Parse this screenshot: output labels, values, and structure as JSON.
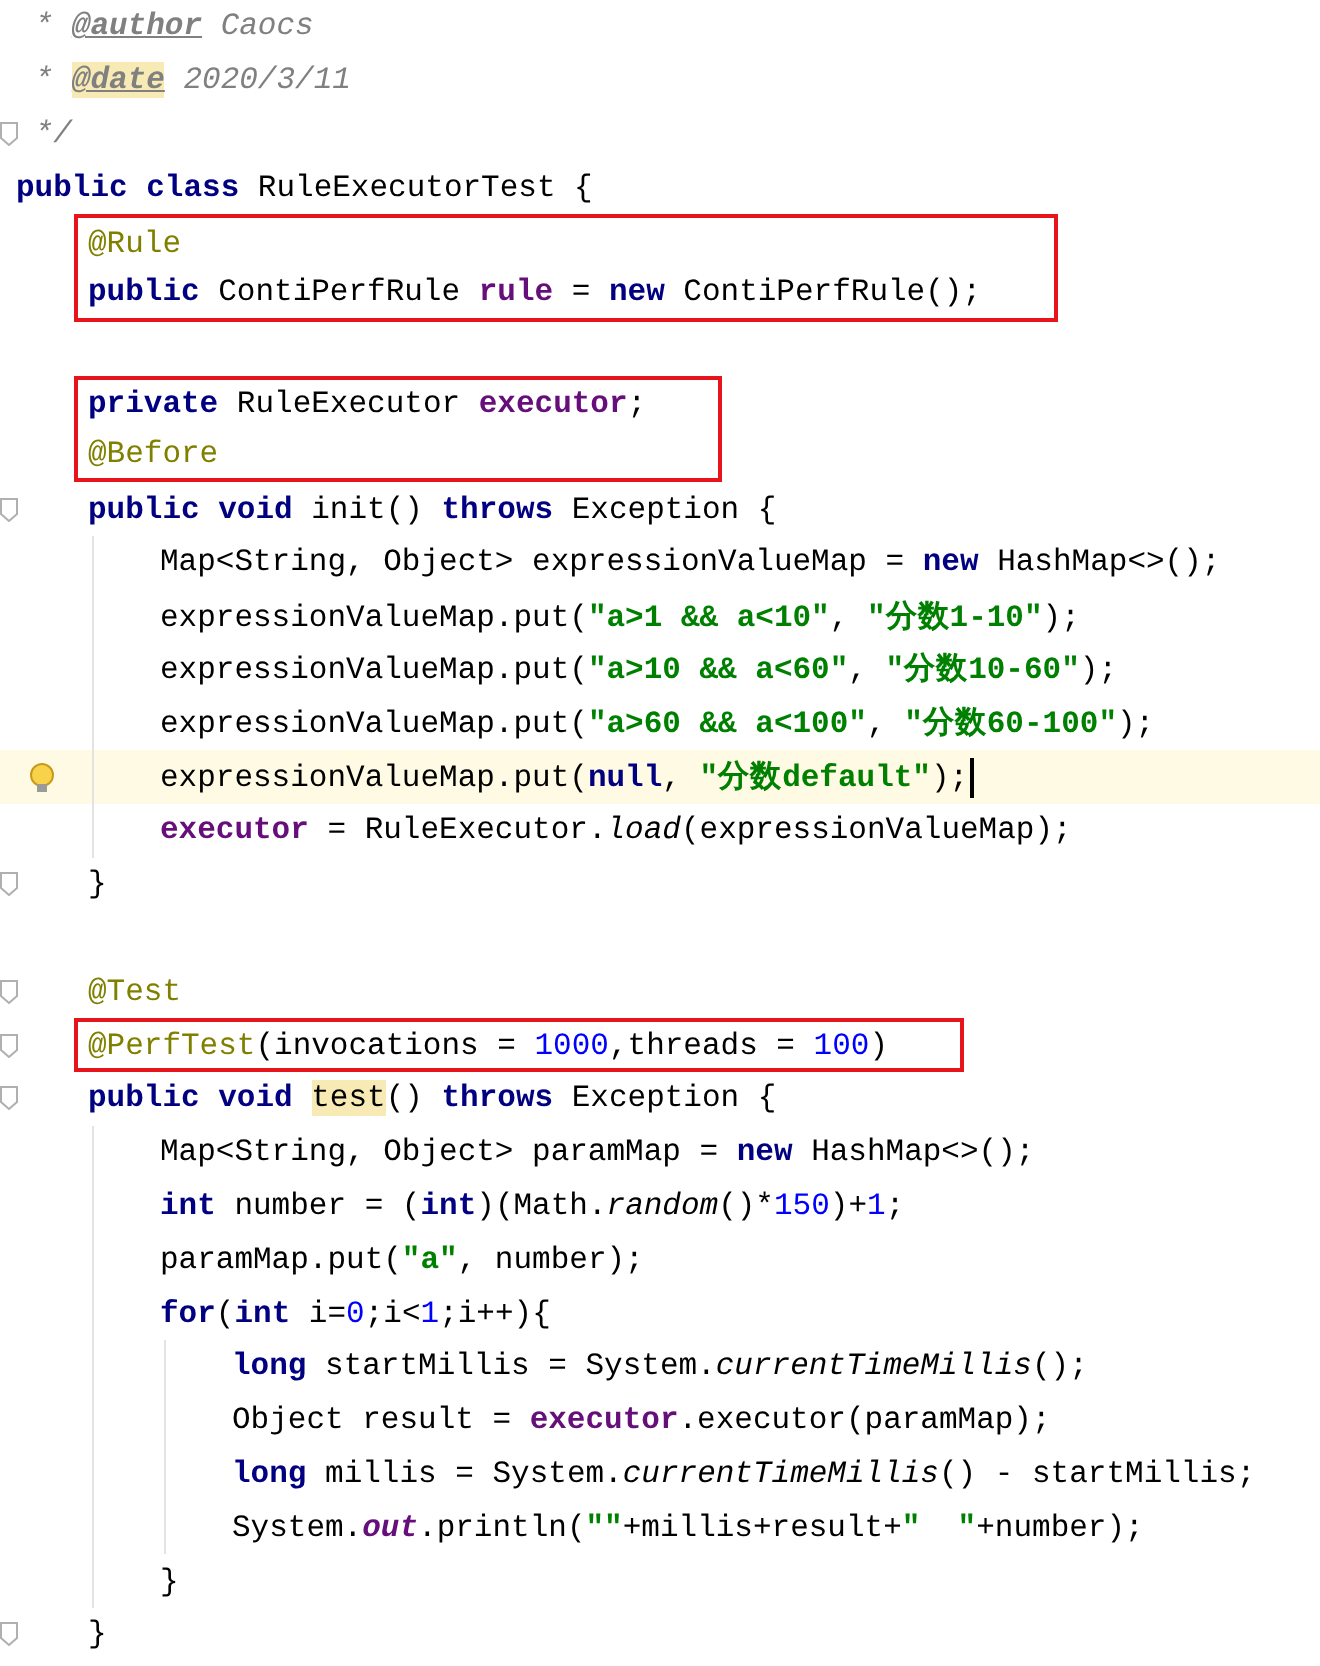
{
  "editor": {
    "lines": [
      {
        "kind": "code",
        "fold": false,
        "current": false,
        "tokens": [
          {
            "kind": "comment",
            "text": " * "
          },
          {
            "kind": "doc_tag",
            "text": "@author"
          },
          {
            "kind": "comment",
            "text": " Caocs"
          }
        ]
      },
      {
        "kind": "code",
        "fold": false,
        "current": false,
        "tokens": [
          {
            "kind": "comment",
            "text": " * "
          },
          {
            "kind": "doc_tag",
            "text": "@date",
            "highlighted": true
          },
          {
            "kind": "comment",
            "text": " 2020/3/11"
          }
        ]
      },
      {
        "kind": "code",
        "fold": true,
        "current": false,
        "tokens": [
          {
            "kind": "comment",
            "text": " */"
          }
        ]
      },
      {
        "kind": "code",
        "fold": false,
        "current": false,
        "tokens": [
          {
            "kind": "keyword",
            "text": "public class"
          },
          {
            "kind": "plain",
            "text": " RuleExecutorTest {"
          }
        ],
        "children": [
          {
            "kind": "group",
            "boxed": true,
            "lines": [
              {
                "kind": "code",
                "current": false,
                "tokens": [
                  {
                    "kind": "annotation",
                    "text": "@Rule"
                  }
                ]
              },
              {
                "kind": "code",
                "current": false,
                "tokens": [
                  {
                    "kind": "keyword",
                    "text": "public"
                  },
                  {
                    "kind": "plain",
                    "text": " ContiPerfRule "
                  },
                  {
                    "kind": "field",
                    "text": "rule"
                  },
                  {
                    "kind": "plain",
                    "text": " = "
                  },
                  {
                    "kind": "keyword",
                    "text": "new"
                  },
                  {
                    "kind": "plain",
                    "text": " ContiPerfRule();"
                  }
                ]
              }
            ]
          },
          {
            "kind": "blank"
          },
          {
            "kind": "group",
            "boxed": true,
            "lines": [
              {
                "kind": "code",
                "current": false,
                "tokens": [
                  {
                    "kind": "keyword",
                    "text": "private"
                  },
                  {
                    "kind": "plain",
                    "text": " RuleExecutor "
                  },
                  {
                    "kind": "field",
                    "text": "executor"
                  },
                  {
                    "kind": "plain",
                    "text": ";"
                  }
                ]
              },
              {
                "kind": "code",
                "current": false,
                "tokens": [
                  {
                    "kind": "annotation",
                    "text": "@Before"
                  }
                ]
              }
            ]
          },
          {
            "kind": "code",
            "fold": true,
            "current": false,
            "tokens": [
              {
                "kind": "keyword",
                "text": "public void"
              },
              {
                "kind": "plain",
                "text": " init() "
              },
              {
                "kind": "keyword",
                "text": "throws"
              },
              {
                "kind": "plain",
                "text": " Exception {"
              }
            ],
            "children": [
              {
                "kind": "code",
                "fold": false,
                "current": false,
                "tokens": [
                  {
                    "kind": "plain",
                    "text": "Map<String, Object> expressionValueMap = "
                  },
                  {
                    "kind": "keyword",
                    "text": "new"
                  },
                  {
                    "kind": "plain",
                    "text": " HashMap<>();"
                  }
                ]
              },
              {
                "kind": "code",
                "fold": false,
                "current": false,
                "tokens": [
                  {
                    "kind": "plain",
                    "text": "expressionValueMap.put("
                  },
                  {
                    "kind": "string",
                    "text": "\"a>1 && a<10\""
                  },
                  {
                    "kind": "plain",
                    "text": ", "
                  },
                  {
                    "kind": "string",
                    "text": "\"分数1-10\""
                  },
                  {
                    "kind": "plain",
                    "text": ");"
                  }
                ]
              },
              {
                "kind": "code",
                "fold": false,
                "current": false,
                "tokens": [
                  {
                    "kind": "plain",
                    "text": "expressionValueMap.put("
                  },
                  {
                    "kind": "string",
                    "text": "\"a>10 && a<60\""
                  },
                  {
                    "kind": "plain",
                    "text": ", "
                  },
                  {
                    "kind": "string",
                    "text": "\"分数10-60\""
                  },
                  {
                    "kind": "plain",
                    "text": ");"
                  }
                ]
              },
              {
                "kind": "code",
                "fold": false,
                "current": false,
                "tokens": [
                  {
                    "kind": "plain",
                    "text": "expressionValueMap.put("
                  },
                  {
                    "kind": "string",
                    "text": "\"a>60 && a<100\""
                  },
                  {
                    "kind": "plain",
                    "text": ", "
                  },
                  {
                    "kind": "string",
                    "text": "\"分数60-100\""
                  },
                  {
                    "kind": "plain",
                    "text": ");"
                  }
                ]
              },
              {
                "kind": "code",
                "fold": false,
                "current": true,
                "tokens": [
                  {
                    "kind": "plain",
                    "text": "expressionValueMap.put("
                  },
                  {
                    "kind": "keyword",
                    "text": "null"
                  },
                  {
                    "kind": "plain",
                    "text": ", "
                  },
                  {
                    "kind": "string",
                    "text": "\"分数default\""
                  },
                  {
                    "kind": "plain",
                    "text": ");"
                  }
                ]
              },
              {
                "kind": "code",
                "fold": false,
                "current": false,
                "tokens": [
                  {
                    "kind": "field",
                    "text": "executor"
                  },
                  {
                    "kind": "plain",
                    "text": " = RuleExecutor."
                  },
                  {
                    "kind": "static_call",
                    "text": "load"
                  },
                  {
                    "kind": "plain",
                    "text": "(expressionValueMap);"
                  }
                ]
              }
            ]
          },
          {
            "kind": "code",
            "fold": true,
            "current": false,
            "tokens": [
              {
                "kind": "plain",
                "text": "}"
              }
            ]
          },
          {
            "kind": "blank"
          },
          {
            "kind": "code",
            "fold": true,
            "current": false,
            "tokens": [
              {
                "kind": "annotation",
                "text": "@Test"
              }
            ]
          },
          {
            "kind": "group",
            "boxed": true,
            "lines": [
              {
                "kind": "code",
                "fold": true,
                "current": false,
                "tokens": [
                  {
                    "kind": "annotation",
                    "text": "@PerfTest"
                  },
                  {
                    "kind": "plain",
                    "text": "(invocations = "
                  },
                  {
                    "kind": "number",
                    "text": "1000"
                  },
                  {
                    "kind": "plain",
                    "text": ",threads = "
                  },
                  {
                    "kind": "number",
                    "text": "100"
                  },
                  {
                    "kind": "plain",
                    "text": ")"
                  }
                ]
              }
            ]
          },
          {
            "kind": "code",
            "fold": true,
            "current": false,
            "tokens": [
              {
                "kind": "keyword",
                "text": "public void "
              },
              {
                "kind": "plain",
                "text": "test",
                "highlighted": true
              },
              {
                "kind": "plain",
                "text": "() "
              },
              {
                "kind": "keyword",
                "text": "throws"
              },
              {
                "kind": "plain",
                "text": " Exception {"
              }
            ],
            "children": [
              {
                "kind": "code",
                "fold": false,
                "current": false,
                "tokens": [
                  {
                    "kind": "plain",
                    "text": "Map<String, Object> paramMap = "
                  },
                  {
                    "kind": "keyword",
                    "text": "new"
                  },
                  {
                    "kind": "plain",
                    "text": " HashMap<>();"
                  }
                ]
              },
              {
                "kind": "code",
                "fold": false,
                "current": false,
                "tokens": [
                  {
                    "kind": "keyword",
                    "text": "int"
                  },
                  {
                    "kind": "plain",
                    "text": " number = ("
                  },
                  {
                    "kind": "keyword",
                    "text": "int"
                  },
                  {
                    "kind": "plain",
                    "text": ")(Math."
                  },
                  {
                    "kind": "static_call",
                    "text": "random"
                  },
                  {
                    "kind": "plain",
                    "text": "()*"
                  },
                  {
                    "kind": "number",
                    "text": "150"
                  },
                  {
                    "kind": "plain",
                    "text": ")+"
                  },
                  {
                    "kind": "number",
                    "text": "1"
                  },
                  {
                    "kind": "plain",
                    "text": ";"
                  }
                ]
              },
              {
                "kind": "code",
                "fold": false,
                "current": false,
                "tokens": [
                  {
                    "kind": "plain",
                    "text": "paramMap.put("
                  },
                  {
                    "kind": "string",
                    "text": "\"a\""
                  },
                  {
                    "kind": "plain",
                    "text": ", number);"
                  }
                ]
              },
              {
                "kind": "code",
                "fold": false,
                "current": false,
                "tokens": [
                  {
                    "kind": "keyword",
                    "text": "for"
                  },
                  {
                    "kind": "plain",
                    "text": "("
                  },
                  {
                    "kind": "keyword",
                    "text": "int"
                  },
                  {
                    "kind": "plain",
                    "text": " i="
                  },
                  {
                    "kind": "number",
                    "text": "0"
                  },
                  {
                    "kind": "plain",
                    "text": ";i<"
                  },
                  {
                    "kind": "number",
                    "text": "1"
                  },
                  {
                    "kind": "plain",
                    "text": ";i++){"
                  }
                ],
                "children": [
                  {
                    "kind": "code",
                    "fold": false,
                    "current": false,
                    "tokens": [
                      {
                        "kind": "keyword",
                        "text": "long"
                      },
                      {
                        "kind": "plain",
                        "text": " startMillis = System."
                      },
                      {
                        "kind": "static_call",
                        "text": "currentTimeMillis"
                      },
                      {
                        "kind": "plain",
                        "text": "();"
                      }
                    ]
                  },
                  {
                    "kind": "code",
                    "fold": false,
                    "current": false,
                    "tokens": [
                      {
                        "kind": "plain",
                        "text": "Object result = "
                      },
                      {
                        "kind": "field",
                        "text": "executor"
                      },
                      {
                        "kind": "plain",
                        "text": ".executor(paramMap);"
                      }
                    ]
                  },
                  {
                    "kind": "code",
                    "fold": false,
                    "current": false,
                    "tokens": [
                      {
                        "kind": "keyword",
                        "text": "long"
                      },
                      {
                        "kind": "plain",
                        "text": " millis = System."
                      },
                      {
                        "kind": "static_call",
                        "text": "currentTimeMillis"
                      },
                      {
                        "kind": "plain",
                        "text": "() - startMillis;"
                      }
                    ]
                  },
                  {
                    "kind": "code",
                    "fold": false,
                    "current": false,
                    "tokens": [
                      {
                        "kind": "plain",
                        "text": "System."
                      },
                      {
                        "kind": "static_field",
                        "text": "out"
                      },
                      {
                        "kind": "plain",
                        "text": ".println("
                      },
                      {
                        "kind": "string",
                        "text": "\"\""
                      },
                      {
                        "kind": "plain",
                        "text": "+millis+result+"
                      },
                      {
                        "kind": "string",
                        "text": "\"  \""
                      },
                      {
                        "kind": "plain",
                        "text": "+number);"
                      }
                    ]
                  }
                ]
              },
              {
                "kind": "code",
                "fold": false,
                "current": false,
                "tokens": [
                  {
                    "kind": "plain",
                    "text": "}"
                  }
                ]
              }
            ]
          },
          {
            "kind": "code",
            "fold": true,
            "current": false,
            "tokens": [
              {
                "kind": "plain",
                "text": "}"
              }
            ]
          }
        ]
      }
    ]
  }
}
